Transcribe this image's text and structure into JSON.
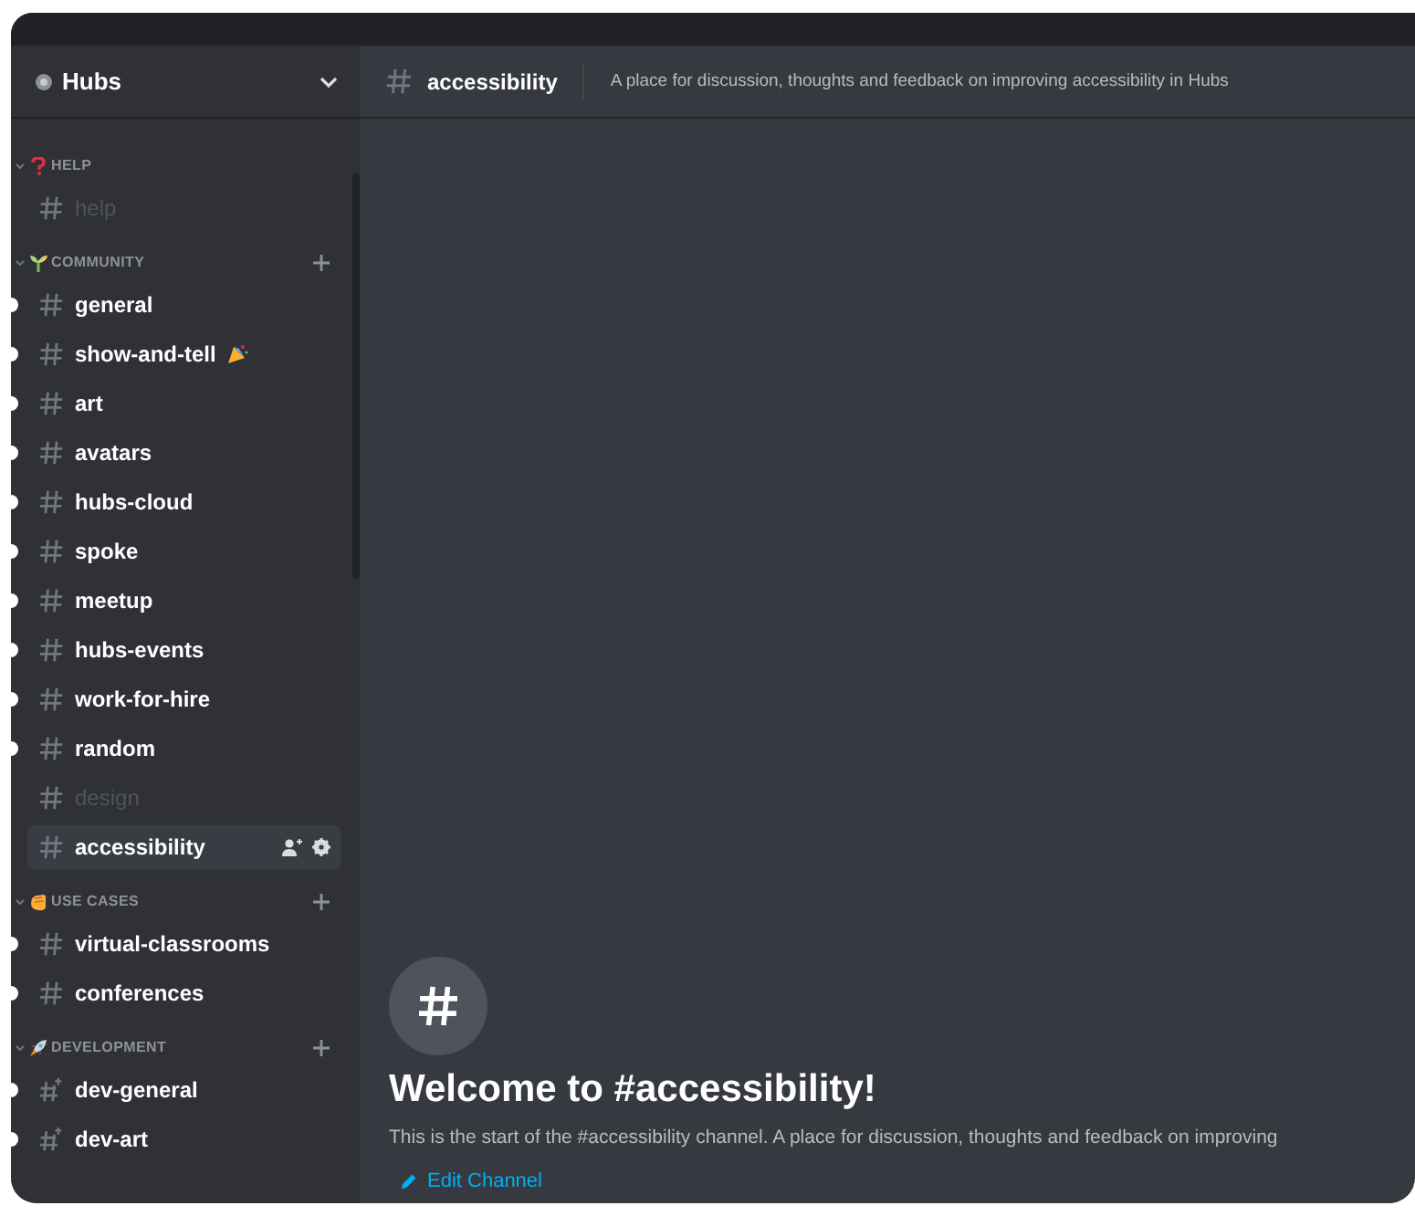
{
  "server": {
    "name": "Hubs"
  },
  "categories": [
    {
      "name": "HELP",
      "add_button": false,
      "channels": [
        {
          "name": "help",
          "kind": "text",
          "unread": false,
          "muted": true,
          "selected": false
        }
      ]
    },
    {
      "name": "COMMUNITY",
      "add_button": true,
      "channels": [
        {
          "name": "general",
          "kind": "text",
          "unread": true,
          "muted": false,
          "selected": false
        },
        {
          "name": "show-and-tell",
          "kind": "text",
          "unread": true,
          "muted": false,
          "selected": false
        },
        {
          "name": "art",
          "kind": "text",
          "unread": true,
          "muted": false,
          "selected": false
        },
        {
          "name": "avatars",
          "kind": "text",
          "unread": true,
          "muted": false,
          "selected": false
        },
        {
          "name": "hubs-cloud",
          "kind": "text",
          "unread": true,
          "muted": false,
          "selected": false
        },
        {
          "name": "spoke",
          "kind": "text",
          "unread": true,
          "muted": false,
          "selected": false
        },
        {
          "name": "meetup",
          "kind": "text",
          "unread": true,
          "muted": false,
          "selected": false
        },
        {
          "name": "hubs-events",
          "kind": "text",
          "unread": true,
          "muted": false,
          "selected": false
        },
        {
          "name": "work-for-hire",
          "kind": "text",
          "unread": true,
          "muted": false,
          "selected": false
        },
        {
          "name": "random",
          "kind": "text",
          "unread": true,
          "muted": false,
          "selected": false
        },
        {
          "name": "design",
          "kind": "text",
          "unread": false,
          "muted": true,
          "selected": false
        },
        {
          "name": "accessibility",
          "kind": "text",
          "unread": false,
          "muted": false,
          "selected": true
        }
      ]
    },
    {
      "name": "USE CASES",
      "add_button": true,
      "channels": [
        {
          "name": "virtual-classrooms",
          "kind": "text",
          "unread": true,
          "muted": false,
          "selected": false
        },
        {
          "name": "conferences",
          "kind": "text",
          "unread": true,
          "muted": false,
          "selected": false
        }
      ]
    },
    {
      "name": "DEVELOPMENT",
      "add_button": true,
      "channels": [
        {
          "name": "dev-general",
          "kind": "thread",
          "unread": true,
          "muted": false,
          "selected": false
        },
        {
          "name": "dev-art",
          "kind": "thread",
          "unread": true,
          "muted": false,
          "selected": false
        }
      ]
    }
  ],
  "header": {
    "channel": "accessibility",
    "topic": "A place for discussion, thoughts and feedback on improving accessibility in Hubs"
  },
  "welcome": {
    "title": "Welcome to #accessibility!",
    "description": "This is the start of the #accessibility channel. A place for discussion, thoughts and feedback on improving",
    "edit_link": "Edit Channel"
  }
}
